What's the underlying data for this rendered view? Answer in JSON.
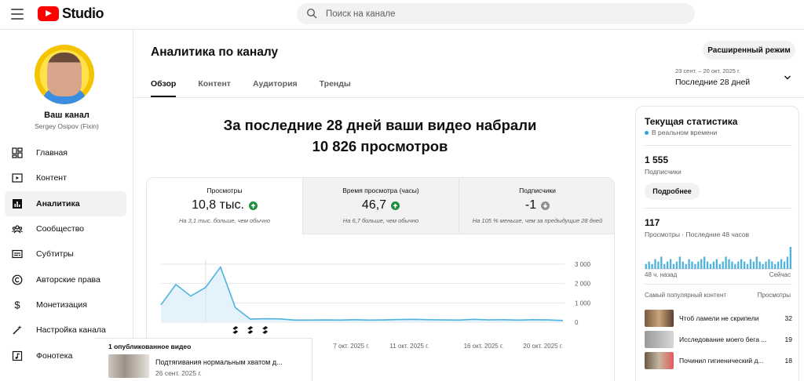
{
  "app": {
    "logo_text": "Studio"
  },
  "search": {
    "placeholder": "Поиск на канале"
  },
  "channel": {
    "title": "Ваш канал",
    "name": "Sergey Osipov (Fixin)"
  },
  "sidebar": {
    "items": [
      {
        "label": "Главная",
        "icon": "dashboard-icon"
      },
      {
        "label": "Контент",
        "icon": "content-icon"
      },
      {
        "label": "Аналитика",
        "icon": "analytics-icon",
        "active": true
      },
      {
        "label": "Сообщество",
        "icon": "community-icon"
      },
      {
        "label": "Субтитры",
        "icon": "subtitles-icon"
      },
      {
        "label": "Авторские права",
        "icon": "copyright-icon"
      },
      {
        "label": "Монетизация",
        "icon": "monetization-icon"
      },
      {
        "label": "Настройка канала",
        "icon": "customization-icon"
      },
      {
        "label": "Фонотека",
        "icon": "audio-library-icon"
      }
    ]
  },
  "header": {
    "title": "Аналитика по каналу",
    "advanced_button": "Расширенный режим",
    "tabs": [
      {
        "label": "Обзор",
        "active": true
      },
      {
        "label": "Контент"
      },
      {
        "label": "Аудитория"
      },
      {
        "label": "Тренды"
      }
    ],
    "range": {
      "dates": "23 сент. – 20 окт. 2025 г.",
      "label": "Последние 28 дней"
    }
  },
  "summary": {
    "line1": "За последние 28 дней ваши видео набрали",
    "line2": "10 826 просмотров"
  },
  "metrics": [
    {
      "label": "Просмотры",
      "value": "10,8 тыс.",
      "trend": "up",
      "note": "На 3,1 тыс. больше, чем обычно",
      "selected": true
    },
    {
      "label": "Время просмотра (часы)",
      "value": "46,7",
      "trend": "up",
      "note": "На 6,7 больше, чем обычно"
    },
    {
      "label": "Подписчики",
      "value": "-1",
      "trend": "down",
      "note": "На 105 % меньше, чем за предыдущие 28 дней"
    }
  ],
  "colors": {
    "accent_line": "#4fb3dd",
    "area_fill": "#e3f2fb",
    "up": "#1e8e3e",
    "down": "#909090",
    "live_dot": "#2aa4e0"
  },
  "chart_data": {
    "type": "line",
    "x": [
      "23 сент.",
      "24 сент.",
      "25 сент.",
      "26 сент.",
      "27 сент.",
      "28 сент.",
      "29 сент.",
      "30 сент.",
      "1 окт.",
      "2 окт.",
      "3 окт.",
      "4 окт.",
      "5 окт.",
      "6 окт.",
      "7 окт.",
      "8 окт.",
      "9 окт.",
      "10 окт.",
      "11 окт.",
      "12 окт.",
      "13 окт.",
      "14 окт.",
      "15 окт.",
      "16 окт.",
      "17 окт.",
      "18 окт.",
      "19 окт.",
      "20 окт."
    ],
    "series": [
      {
        "values": [
          900,
          1950,
          1350,
          1800,
          2850,
          750,
          160,
          180,
          170,
          110,
          110,
          120,
          110,
          130,
          110,
          120,
          140,
          150,
          130,
          120,
          110,
          150,
          120,
          130,
          110,
          130,
          120,
          90
        ]
      }
    ],
    "ylim": [
      0,
      3000
    ],
    "y_ticks": [
      "0",
      "1 000",
      "2 000",
      "3 000"
    ],
    "x_tick_labels": [
      {
        "index": 14,
        "label": "7 окт. 2025 г."
      },
      {
        "index": 18,
        "label": "11 окт. 2025 г."
      },
      {
        "index": 23,
        "label": "16 окт. 2025 г."
      },
      {
        "index": 27,
        "label": "20 окт. 2025 г."
      }
    ],
    "shorts_markers": [
      5,
      6,
      7
    ],
    "grid": true
  },
  "published": {
    "heading": "1 опубликованное видео",
    "title": "Подтягивания нормальным хватом д...",
    "date": "26 сент. 2025 г."
  },
  "realtime": {
    "title": "Текущая статистика",
    "live_label": "В реальном времени",
    "subscribers": "1 555",
    "subscribers_label": "Подписчики",
    "more_button": "Подробнее",
    "views": "117",
    "views_label": "Просмотры · Последние 48 часов",
    "spark_values": [
      2,
      3,
      2,
      4,
      3,
      5,
      2,
      3,
      4,
      2,
      3,
      5,
      3,
      2,
      4,
      3,
      2,
      3,
      4,
      5,
      3,
      2,
      3,
      4,
      2,
      3,
      5,
      4,
      3,
      2,
      3,
      4,
      3,
      2,
      4,
      3,
      5,
      3,
      2,
      3,
      4,
      3,
      2,
      3,
      4,
      3,
      5,
      9
    ],
    "axis_left": "48 ч. назад",
    "axis_right": "Сейчас",
    "top_heading": "Самый популярный контент",
    "top_metric": "Просмотры",
    "top": [
      {
        "title": "Чтоб ламели не скрипели",
        "count": "32"
      },
      {
        "title": "Исследование моего бега ...",
        "count": "19"
      },
      {
        "title": "Починил гигиенический д...",
        "count": "18"
      }
    ]
  }
}
